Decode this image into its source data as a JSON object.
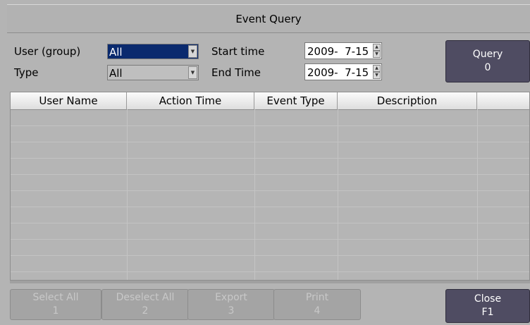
{
  "window": {
    "title": "Event Query"
  },
  "filters": {
    "user_group_label": "User (group)",
    "user_group_value": "All",
    "type_label": "Type",
    "type_value": "All",
    "start_time_label": "Start time",
    "start_time_value": "2009-  7-15",
    "end_time_label": "End Time",
    "end_time_value": "2009-  7-15"
  },
  "query_button": {
    "label": "Query",
    "key": "0"
  },
  "table": {
    "columns": [
      "User Name",
      "Action Time",
      "Event Type",
      "Description",
      ""
    ],
    "rows": []
  },
  "actions": [
    {
      "label": "Select All",
      "key": "1"
    },
    {
      "label": "Deselect All",
      "key": "2"
    },
    {
      "label": "Export",
      "key": "3"
    },
    {
      "label": "Print",
      "key": "4"
    }
  ],
  "close_button": {
    "label": "Close",
    "key": "F1"
  },
  "colors": {
    "selected_combo": "#0a2a6e",
    "dark_button": "#4f4c62",
    "background": "#b4b4b4"
  }
}
